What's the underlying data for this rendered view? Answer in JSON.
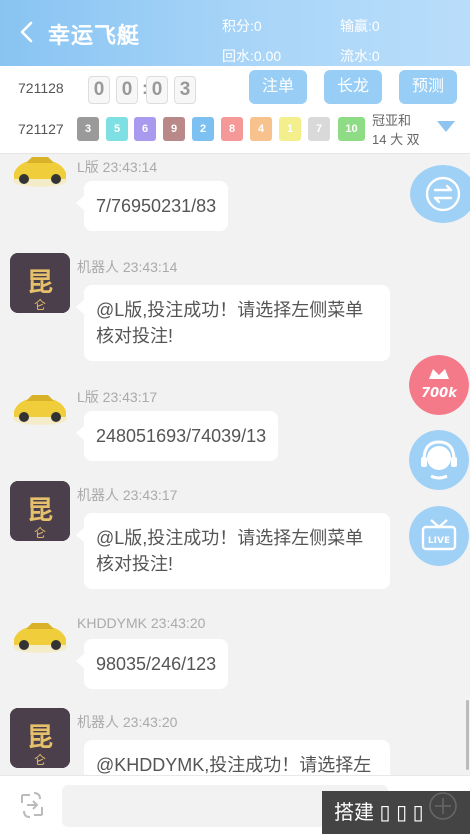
{
  "header": {
    "title": "幸运飞艇",
    "stats": {
      "points": "积分:0",
      "win_loss": "输赢:0",
      "rebate": "回水:0.00",
      "turnover": "流水:0"
    }
  },
  "current_issue": {
    "number": "721128",
    "countdown_digits": [
      "0",
      "0",
      "0",
      "3"
    ],
    "colon": ":"
  },
  "toolbar": {
    "bet_label": "注单",
    "long_dragon_label": "长龙",
    "predict_label": "预测"
  },
  "last_issue": {
    "number": "721127",
    "balls": [
      {
        "n": "3",
        "color": "#9a9a9a"
      },
      {
        "n": "5",
        "color": "#7fe0e3"
      },
      {
        "n": "6",
        "color": "#a99af0"
      },
      {
        "n": "9",
        "color": "#b98888"
      },
      {
        "n": "2",
        "color": "#7cc1f2"
      },
      {
        "n": "8",
        "color": "#f59898"
      },
      {
        "n": "4",
        "color": "#f8c28f"
      },
      {
        "n": "1",
        "color": "#f2ef8c"
      },
      {
        "n": "7",
        "color": "#d9d9d9"
      },
      {
        "n": "10",
        "color": "#8fdc86"
      }
    ],
    "result_label": "冠亚和",
    "result_value": "14 大 双"
  },
  "messages": [
    {
      "sender": "L版 23:43:14",
      "text": "7/76950231/83",
      "avatar": "car"
    },
    {
      "sender": "机器人 23:43:14",
      "text": "@L版,投注成功！请选择左侧菜单核对投注!",
      "avatar": "bot"
    },
    {
      "sender": "L版 23:43:17",
      "text": "248051693/74039/13",
      "avatar": "car"
    },
    {
      "sender": "机器人 23:43:17",
      "text": "@L版,投注成功！请选择左侧菜单核对投注!",
      "avatar": "bot"
    },
    {
      "sender": "KHDDYMK 23:43:20",
      "text": "98035/246/123",
      "avatar": "car"
    },
    {
      "sender": "机器人 23:43:20",
      "text": "@KHDDYMK,投注成功！请选择左",
      "avatar": "bot"
    }
  ],
  "side_buttons": {
    "promo_text": "700k",
    "live_text": "LIVE"
  },
  "bottom": {
    "toast": "搭建 ▯ ▯ ▯"
  },
  "colors": {
    "accent": "#98cdf5",
    "header_start": "#88c4f2",
    "promo": "#f47a8a"
  }
}
